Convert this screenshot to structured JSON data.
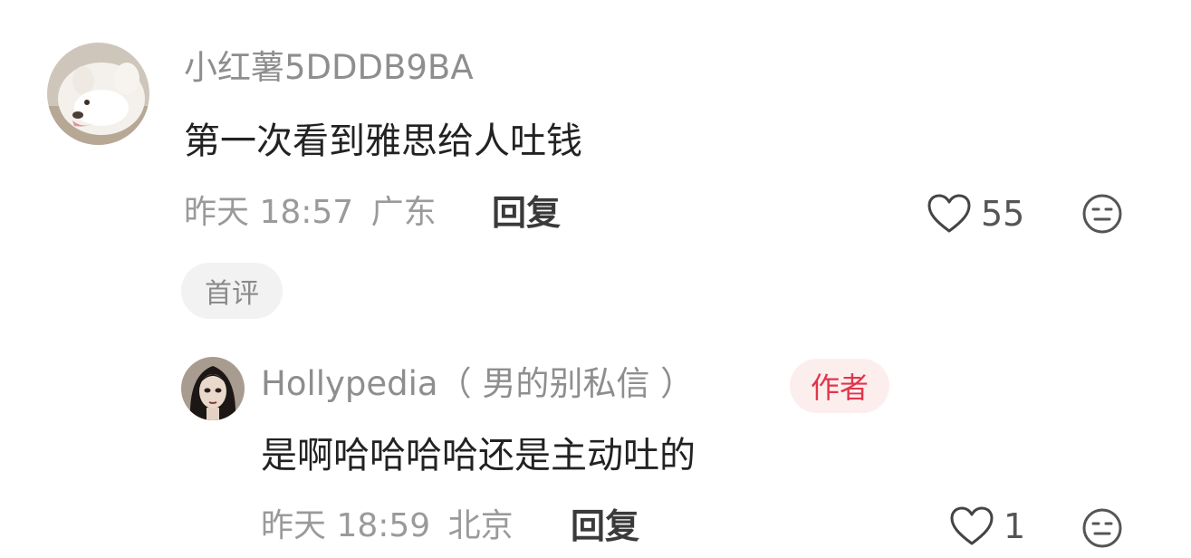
{
  "comment": {
    "avatar": "samoyed-dog-avatar",
    "username": "小红薯5DDDB9BA",
    "text": "第一次看到雅思给人吐钱",
    "time": "昨天 18:57",
    "location": "广东",
    "reply_label": "回复",
    "likes": "55",
    "tag": "首评"
  },
  "reply": {
    "avatar": "girl-portrait-avatar",
    "username": "Hollypedia（ 男的别私信 ）",
    "badge": "作者",
    "text": "是啊哈哈哈哈还是主动吐的",
    "time": "昨天 18:59",
    "location": "北京",
    "reply_label": "回复",
    "likes": "1"
  },
  "colors": {
    "badge_text": "#e0364b",
    "badge_bg": "#fdeeee",
    "tag_bg": "#f2f2f2"
  }
}
